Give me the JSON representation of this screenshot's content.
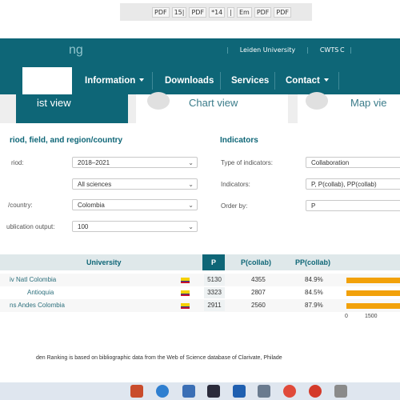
{
  "browser": {
    "toolbar_items": [
      "PDF",
      "15|",
      "PDF",
      "*14",
      "|",
      "Em",
      "PDF",
      "PDF"
    ]
  },
  "header": {
    "brand": "ng",
    "links": [
      "Leiden University",
      "CWTS",
      "C"
    ]
  },
  "nav": {
    "items": [
      {
        "label": "Information",
        "dropdown": true
      },
      {
        "label": "Downloads",
        "dropdown": false
      },
      {
        "label": "Services",
        "dropdown": false
      },
      {
        "label": "Contact",
        "dropdown": true
      }
    ]
  },
  "tabs": {
    "list": "ist view",
    "chart": "Chart view",
    "map": "Map vie"
  },
  "filters": {
    "title": "riod, field, and region/country",
    "period_label": "riod:",
    "period_value": "2018–2021",
    "field_value": "All sciences",
    "region_label": "/country:",
    "region_value": "Colombia",
    "min_output_label": "ublication output:",
    "min_output_value": "100"
  },
  "indicators": {
    "title": "Indicators",
    "type_label": "Type of indicators:",
    "type_value": "Collaboration",
    "ind_label": "Indicators:",
    "ind_value": "P, P(collab), PP(collab)",
    "order_label": "Order by:",
    "order_value": "P"
  },
  "table": {
    "headers": {
      "university": "University",
      "p": "P",
      "p_collab": "P(collab)",
      "pp_collab": "PP(collab)"
    },
    "rows": [
      {
        "university": "iv Natl Colombia",
        "p": "5130",
        "p_collab": "4355",
        "pp_collab": "84.9%"
      },
      {
        "university": "Antioquia",
        "p": "3323",
        "p_collab": "2807",
        "pp_collab": "84.5%"
      },
      {
        "university": "ns Andes Colombia",
        "p": "2911",
        "p_collab": "2560",
        "pp_collab": "87.9%"
      }
    ],
    "axis_ticks": [
      "0",
      "1500"
    ]
  },
  "chart_data": {
    "type": "bar",
    "categories": [
      "iv Natl Colombia",
      "Antioquia",
      "ns Andes Colombia"
    ],
    "values": [
      5130,
      3323,
      2911
    ],
    "xlim": [
      0,
      1500
    ]
  },
  "footer": {
    "text": "den Ranking is based on bibliographic data from the Web of Science database of Clarivate, Philade"
  },
  "colors": {
    "teal": "#0e6677",
    "bar": "#f2a10a",
    "header_row": "#dfe8ea"
  },
  "taskbar": {
    "icons": [
      "acrobat-icon",
      "edge-icon",
      "calendar-icon",
      "teams-icon",
      "word-icon",
      "photos-icon",
      "chrome-icon",
      "pdf-reader-icon",
      "settings-icon"
    ]
  }
}
